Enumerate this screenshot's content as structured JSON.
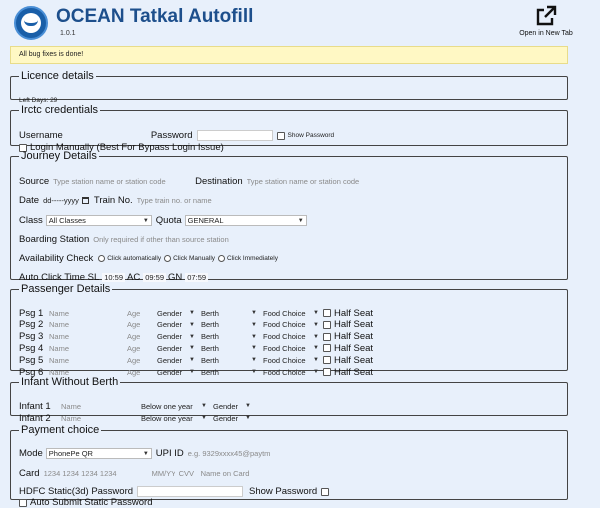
{
  "header": {
    "title": "OCEAN Tatkal Autofill",
    "version": "1.0.1",
    "open_new_tab": "Open in New Tab"
  },
  "alert": "All bug fixes is done!",
  "licence": {
    "legend": "Licence details",
    "left_days": "Left Days: 29"
  },
  "irctc": {
    "legend": "Irctc credentials",
    "username_label": "Username",
    "password_label": "Password",
    "show_password": "Show Password",
    "login_manually": "Login Manually (Best For Bypass Login Issue)"
  },
  "journey": {
    "legend": "Journey Details",
    "source_label": "Source",
    "source_placeholder": "Type station name or station code",
    "destination_label": "Destination",
    "destination_placeholder": "Type station name or station code",
    "date_label": "Date",
    "date_value": "dd-----yyyy",
    "train_label": "Train No.",
    "train_placeholder": "Type train no. or name",
    "class_label": "Class",
    "class_value": "All Classes",
    "quota_label": "Quota",
    "quota_value": "GENERAL",
    "boarding_label": "Boarding Station",
    "boarding_placeholder": "Only required if other than source station",
    "availability_label": "Availability Check",
    "avail_options": [
      "Click automatically",
      "Click Manually",
      "Click Immediately"
    ],
    "auto_click_label": "Auto Click Time SL",
    "sl_time": "10:59",
    "ac_label": "AC",
    "ac_time": "09:59",
    "gn_label": "GN",
    "gn_time": "07:59"
  },
  "passengers": {
    "legend": "Passenger Details",
    "rows": [
      {
        "label": "Psg 1"
      },
      {
        "label": "Psg 2"
      },
      {
        "label": "Psg 3"
      },
      {
        "label": "Psg 4"
      },
      {
        "label": "Psg 5"
      },
      {
        "label": "Psg 6"
      }
    ],
    "name_placeholder": "Name",
    "age_placeholder": "Age",
    "gender": "Gender",
    "berth": "Berth",
    "food": "Food Choice",
    "half_seat": "Half Seat"
  },
  "infants": {
    "legend": "Infant Without Berth",
    "rows": [
      {
        "label": "Infant 1"
      },
      {
        "label": "Infant 2"
      }
    ],
    "name_placeholder": "Name",
    "age": "Below one year",
    "gender": "Gender"
  },
  "payment": {
    "legend": "Payment choice",
    "mode_label": "Mode",
    "mode_value": "PhonePe QR",
    "upi_label": "UPI ID",
    "upi_placeholder": "e.g. 9329xxxx45@paytm",
    "card_label": "Card",
    "card_placeholder": "1234 1234 1234 1234",
    "expiry_placeholder": "MM/YY",
    "cvv_placeholder": "CVV",
    "card_name_placeholder": "Name on Card",
    "hdfc_label": "HDFC Static(3d) Password",
    "show_password": "Show Password",
    "auto_submit": "Auto Submit Static Password"
  }
}
